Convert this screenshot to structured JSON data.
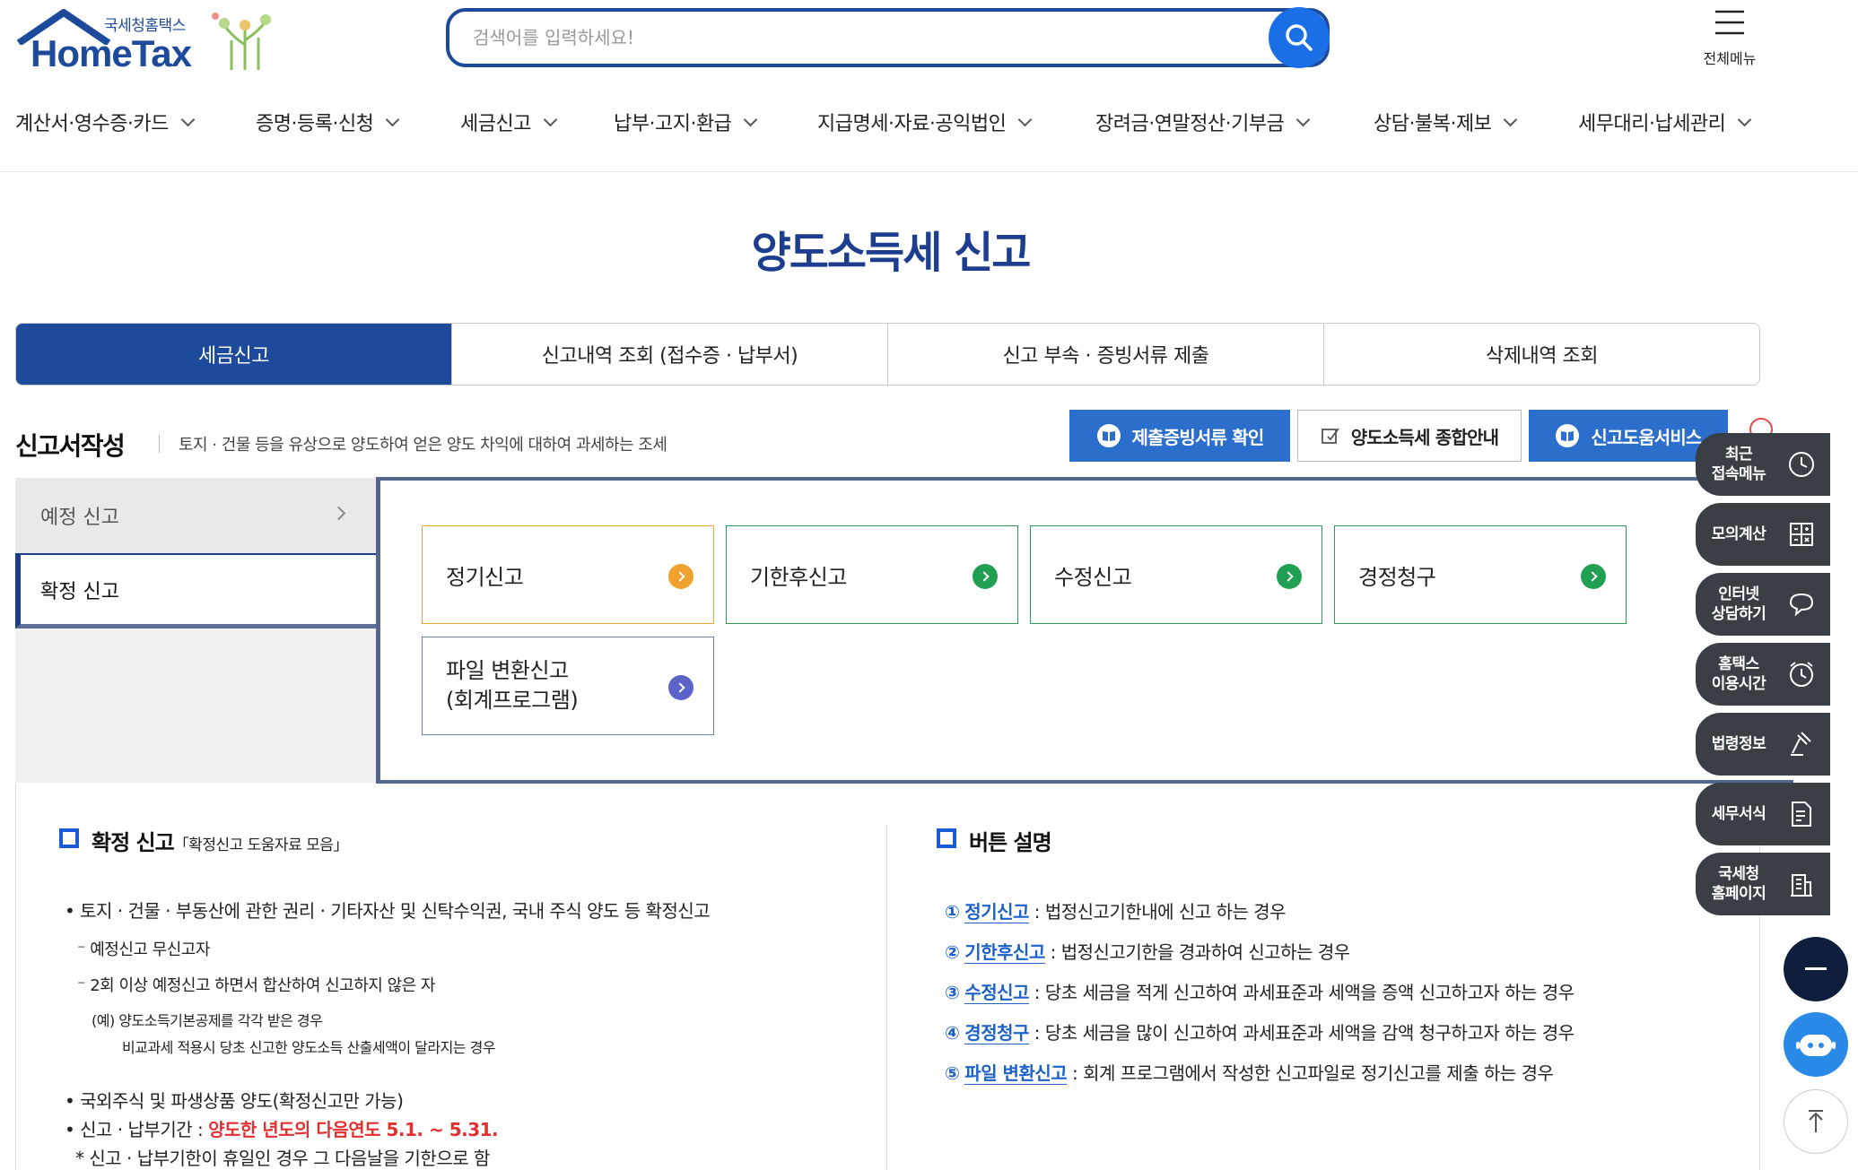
{
  "header": {
    "logo_sub": "국세청홈택스",
    "logo_main": "HomeTax",
    "search_placeholder": "검색어를 입력하세요!",
    "all_menu": "전체메뉴"
  },
  "gnb": [
    "계산서·영수증·카드",
    "증명·등록·신청",
    "세금신고",
    "납부·고지·환급",
    "지급명세·자료·공익법인",
    "장려금·연말정산·기부금",
    "상담·불복·제보",
    "세무대리·납세관리"
  ],
  "page_title": "양도소득세 신고",
  "tabs": [
    "세금신고",
    "신고내역 조회 (접수증 · 납부서)",
    "신고 부속 · 증빙서류 제출",
    "삭제내역 조회"
  ],
  "section": {
    "title": "신고서작성",
    "desc": "토지 · 건물 등을 유상으로 양도하여 얻은 양도 차익에 대하여 과세하는 조세",
    "btn1": "제출증빙서류 확인",
    "btn2": "양도소득세 종합안내",
    "btn3": "신고도움서비스"
  },
  "left_nav": [
    "예정 신고",
    "확정 신고"
  ],
  "cards": [
    {
      "label": "정기신고",
      "color": "#f0a22e"
    },
    {
      "label": "기한후신고",
      "color": "#21a053"
    },
    {
      "label": "수정신고",
      "color": "#21a053"
    },
    {
      "label": "경정청구",
      "color": "#21a053"
    },
    {
      "label1": "파일 변환신고",
      "label2": "(회계프로그램)",
      "color": "#5b63c9"
    }
  ],
  "left_info": {
    "heading": "확정 신고",
    "heading_sub": "「확정신고 도움자료 모음」",
    "l1": "• 토지 · 건물 · 부동산에 관한 권리 · 기타자산 및 신탁수익권, 국내 주식 양도 등 확정신고",
    "l2": "⁻ 예정신고 무신고자",
    "l3": "⁻ 2회 이상 예정신고 하면서 합산하여 신고하지 않은 자",
    "l4": "(예) 양도소득기본공제를 각각 받은 경우",
    "l5": "비교과세 적용시 당초 신고한 양도소득 산출세액이 달라지는 경우",
    "l6": "• 국외주식 및 파생상품 양도(확정신고만 가능)",
    "l7a": "• 신고 · 납부기간 : ",
    "l7b": "양도한 년도의 다음연도 5.1. ~ 5.31.",
    "l8": "* 신고 · 납부기한이 휴일인 경우 그 다음날을 기한으로 함"
  },
  "right_info": {
    "heading": "버튼 설명",
    "items": [
      {
        "num": "①",
        "term": "정기신고",
        "desc": " : 법정신고기한내에 신고 하는 경우"
      },
      {
        "num": "②",
        "term": "기한후신고",
        "desc": " : 법정신고기한을 경과하여 신고하는 경우"
      },
      {
        "num": "③",
        "term": "수정신고",
        "desc": " : 당초 세금을 적게 신고하여 과세표준과 세액을 증액 신고하고자 하는 경우"
      },
      {
        "num": "④",
        "term": "경정청구",
        "desc": " : 당초 세금을 많이 신고하여 과세표준과 세액을 감액 청구하고자 하는 경우"
      },
      {
        "num": "⑤",
        "term": "파일 변환신고",
        "desc": " : 회계 프로그램에서 작성한 신고파일로 정기신고를  제출 하는 경우"
      }
    ]
  },
  "quick_menu": [
    {
      "l1": "최근",
      "l2": "접속메뉴",
      "icon": "clock-icon"
    },
    {
      "l1": "모의계산",
      "l2": "",
      "icon": "calculator-icon"
    },
    {
      "l1": "인터넷",
      "l2": "상담하기",
      "icon": "chat-icon"
    },
    {
      "l1": "홈택스",
      "l2": "이용시간",
      "icon": "alarm-clock-icon"
    },
    {
      "l1": "법령정보",
      "l2": "",
      "icon": "gavel-icon"
    },
    {
      "l1": "세무서식",
      "l2": "",
      "icon": "form-icon"
    },
    {
      "l1": "국세청",
      "l2": "홈페이지",
      "icon": "building-icon"
    }
  ],
  "colors": {
    "primary": "#1d4a9b",
    "accent": "#2c6ecb",
    "quick_bg": "#3a3e45"
  }
}
